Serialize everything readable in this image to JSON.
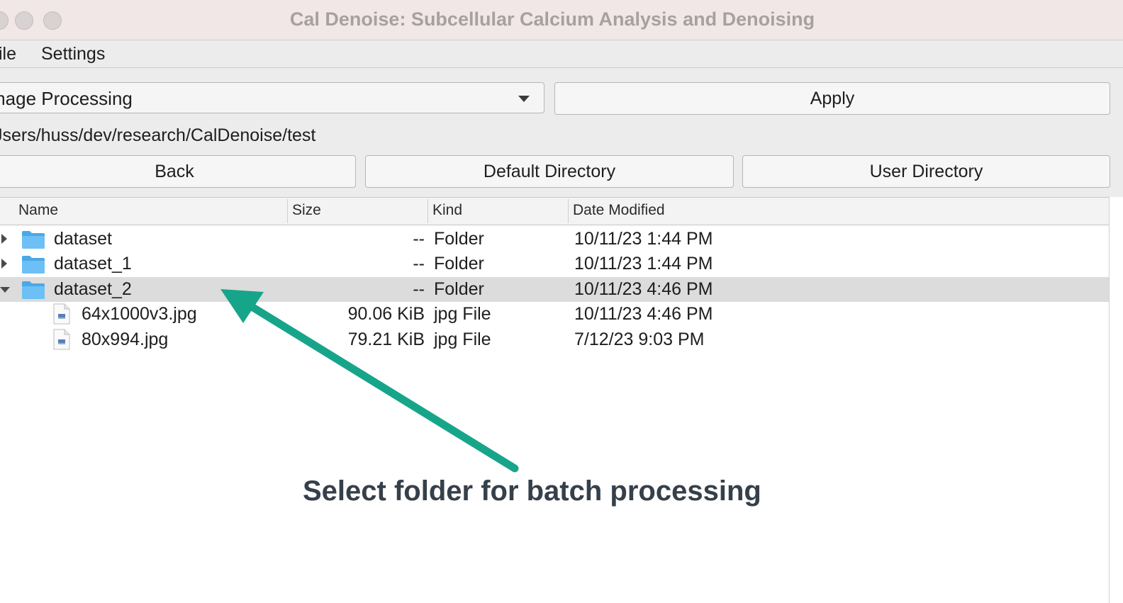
{
  "window": {
    "title": "Cal Denoise: Subcellular Calcium Analysis and Denoising"
  },
  "menubar": {
    "items": [
      {
        "label": "ile"
      },
      {
        "label": "Settings"
      }
    ]
  },
  "toolbar": {
    "mode_select": {
      "value": "mage Processing"
    },
    "apply_label": "Apply"
  },
  "path": {
    "current": "Jsers/huss/dev/research/CalDenoise/test"
  },
  "nav": {
    "back_label": "Back",
    "default_dir_label": "Default Directory",
    "user_dir_label": "User Directory"
  },
  "tree": {
    "columns": [
      "Name",
      "Size",
      "Kind",
      "Date Modified"
    ],
    "rows": [
      {
        "name": "dataset",
        "size": "--",
        "kind": "Folder",
        "modified": "10/11/23 1:44 PM",
        "type": "folder",
        "expanded": false,
        "selected": false
      },
      {
        "name": "dataset_1",
        "size": "--",
        "kind": "Folder",
        "modified": "10/11/23 1:44 PM",
        "type": "folder",
        "expanded": false,
        "selected": false
      },
      {
        "name": "dataset_2",
        "size": "--",
        "kind": "Folder",
        "modified": "10/11/23 4:46 PM",
        "type": "folder",
        "expanded": true,
        "selected": true
      },
      {
        "name": "64x1000v3.jpg",
        "size": "90.06 KiB",
        "kind": "jpg File",
        "modified": "10/11/23 4:46 PM",
        "type": "file"
      },
      {
        "name": "80x994.jpg",
        "size": "79.21 KiB",
        "kind": "jpg File",
        "modified": "7/12/23 9:03 PM",
        "type": "file"
      }
    ]
  },
  "annotation": {
    "text": "Select folder for batch processing",
    "arrow_color": "#17a58a"
  },
  "icons": {
    "folder": "folder-icon",
    "file": "image-file-icon",
    "expand": "disclosure-triangle-icon"
  }
}
